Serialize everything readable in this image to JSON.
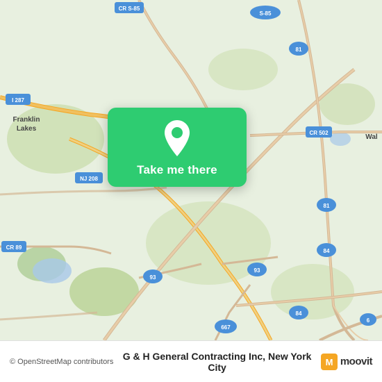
{
  "map": {
    "background_color": "#e8f0e0",
    "alt": "Map of New Jersey showing Franklin Lakes area"
  },
  "cta": {
    "label": "Take me there",
    "pin_alt": "location pin"
  },
  "bottom_bar": {
    "osm_text": "© OpenStreetMap contributors",
    "place_name": "G & H General Contracting Inc, New York City",
    "moovit_text": "moovit"
  },
  "road_labels": [
    {
      "id": "cr_s85",
      "text": "CR S-85"
    },
    {
      "id": "s85",
      "text": "S-85"
    },
    {
      "id": "cr_502",
      "text": "CR 502"
    },
    {
      "id": "r81_top",
      "text": "81"
    },
    {
      "id": "r81_mid",
      "text": "81"
    },
    {
      "id": "r84",
      "text": "84"
    },
    {
      "id": "r84_2",
      "text": "84"
    },
    {
      "id": "r6",
      "text": "6"
    },
    {
      "id": "r667",
      "text": "667"
    },
    {
      "id": "r93_left",
      "text": "93"
    },
    {
      "id": "r93_right",
      "text": "93"
    },
    {
      "id": "cr89",
      "text": "CR 89"
    },
    {
      "id": "r208",
      "text": "NJ 208"
    },
    {
      "id": "i287",
      "text": "I 287"
    },
    {
      "id": "franklin_lakes",
      "text": "Franklin Lakes"
    }
  ]
}
